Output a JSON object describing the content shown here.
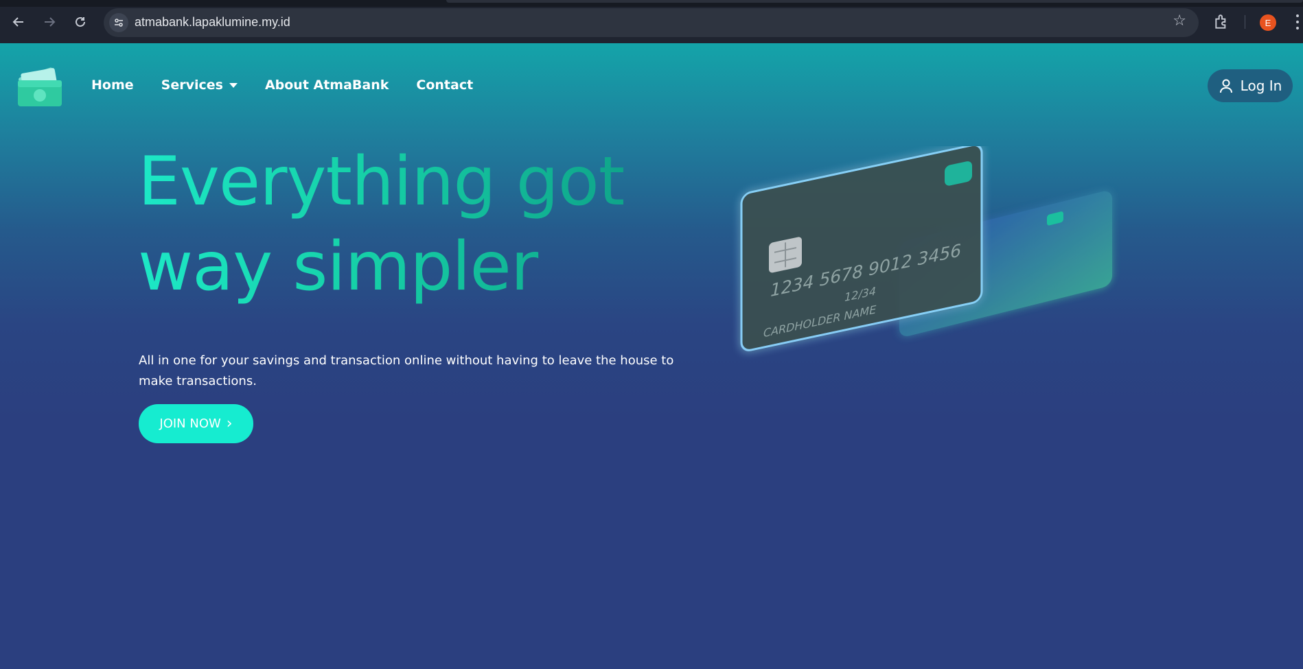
{
  "browser": {
    "url": "atmabank.lapaklumine.my.id",
    "profile_initial": "E",
    "back_icon": "arrow-left-icon",
    "forward_icon": "arrow-right-icon",
    "reload_icon": "reload-icon",
    "bookmark_icon": "star-icon",
    "extensions_icon": "puzzle-icon"
  },
  "nav": {
    "links": [
      "Home",
      "Services",
      "About AtmaBank",
      "Contact"
    ],
    "login_label": "Log In"
  },
  "hero": {
    "title_line1": "Everything got",
    "title_line2": "way simpler",
    "subtitle": "All in one for your savings and transaction online without having to leave the house to make transactions.",
    "cta_label": "JOIN NOW",
    "card": {
      "number": "1234  5678  9012  3456",
      "expiry": "12/34",
      "holder": "CARDHOLDER NAME"
    }
  },
  "colors": {
    "accent": "#16ecd0",
    "nav_button": "#1f5f80",
    "background": "#2b3f7f",
    "header_top": "#14a4a9"
  }
}
